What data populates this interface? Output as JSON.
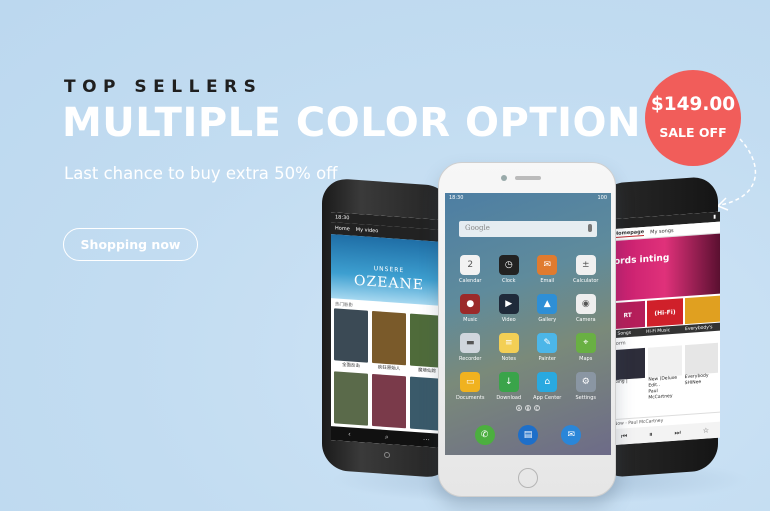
{
  "hero": {
    "eyebrow": "TOP SELLERS",
    "headline": "MULTIPLE COLOR OPTION",
    "subline": "Last chance to buy extra 50% off",
    "cta_label": "Shopping now"
  },
  "badge": {
    "price": "$149.00",
    "label": "SALE OFF",
    "color": "#f15d5a"
  },
  "center_phone": {
    "time": "18:30",
    "battery": "100",
    "search_placeholder": "Google",
    "apps": [
      {
        "label": "Calendar",
        "glyph": "2",
        "color": "#f2f2f2",
        "icon": "calendar-icon"
      },
      {
        "label": "Clock",
        "glyph": "◷",
        "color": "#222222",
        "icon": "clock-icon"
      },
      {
        "label": "Email",
        "glyph": "✉",
        "color": "#e07b2f",
        "icon": "email-icon"
      },
      {
        "label": "Calculator",
        "glyph": "±",
        "color": "#f0f0f0",
        "icon": "calculator-icon"
      },
      {
        "label": "Music",
        "glyph": "●",
        "color": "#9b2a2a",
        "icon": "music-icon"
      },
      {
        "label": "Video",
        "glyph": "▶",
        "color": "#1f2a3a",
        "icon": "video-icon"
      },
      {
        "label": "Gallery",
        "glyph": "▲",
        "color": "#2e8fd6",
        "icon": "gallery-icon"
      },
      {
        "label": "Camera",
        "glyph": "◉",
        "color": "#eeeeee",
        "icon": "camera-icon"
      },
      {
        "label": "Recorder",
        "glyph": "▬",
        "color": "#d0d6dd",
        "icon": "recorder-icon"
      },
      {
        "label": "Notes",
        "glyph": "≡",
        "color": "#f3cf55",
        "icon": "notes-icon"
      },
      {
        "label": "Painter",
        "glyph": "✎",
        "color": "#4cb6e8",
        "icon": "painter-icon"
      },
      {
        "label": "Maps",
        "glyph": "⌖",
        "color": "#69b043",
        "icon": "maps-icon"
      },
      {
        "label": "Documents",
        "glyph": "▭",
        "color": "#f0b21f",
        "icon": "documents-icon"
      },
      {
        "label": "Download",
        "glyph": "↓",
        "color": "#3aa44a",
        "icon": "download-icon"
      },
      {
        "label": "App Center",
        "glyph": "⌂",
        "color": "#29a9e0",
        "icon": "app-center-icon"
      },
      {
        "label": "Settings",
        "glyph": "⚙",
        "color": "#8a96a3",
        "icon": "settings-icon"
      }
    ],
    "page_dots": [
      "A",
      "B",
      "C"
    ],
    "dock": [
      {
        "icon": "phone-icon",
        "glyph": "✆",
        "color": "#4caf3f"
      },
      {
        "icon": "contacts-icon",
        "glyph": "▤",
        "color": "#1e6fc9"
      },
      {
        "icon": "messages-icon",
        "glyph": "✉",
        "color": "#2a86d8"
      }
    ]
  },
  "left_phone": {
    "time": "18:30",
    "tabs": [
      "Home",
      "My video"
    ],
    "banner_small": "UNSERE",
    "banner_title": "OZEANE",
    "section_label": "热门影影",
    "posters": [
      {
        "label": "全面反击",
        "color": "#3b4a55"
      },
      {
        "label": "疯狂原始人",
        "color": "#7a5a2a"
      },
      {
        "label": "魔境仙踪",
        "color": "#4f6b3a"
      },
      {
        "label": "",
        "color": "#5a6a4a"
      },
      {
        "label": "",
        "color": "#7a3a4a"
      },
      {
        "label": "",
        "color": "#3a5a6a"
      }
    ]
  },
  "right_phone": {
    "tabs": [
      "Homepage",
      "My songs"
    ],
    "banner_text": "ords inting",
    "tiles": [
      {
        "label": "RT",
        "color": "#b51e5a"
      },
      {
        "label": "(Hi-Fi)",
        "color": "#d0202a"
      },
      {
        "label": "",
        "color": "#e0a020"
      }
    ],
    "tile_labels": [
      "Songs",
      "Hi-Fi Music",
      "Everybody's"
    ],
    "section": "form",
    "albums": [
      {
        "title": "nding |",
        "artist": "",
        "color": "#2d2d3a"
      },
      {
        "title": "New (Deluxe Edit..",
        "artist": "Paul McCartney",
        "color": "#f0f0f0"
      },
      {
        "title": "Everybody",
        "artist": "SHINee",
        "color": "#e6e6e6"
      }
    ],
    "now_playing": "Now - Paul McCartney"
  }
}
